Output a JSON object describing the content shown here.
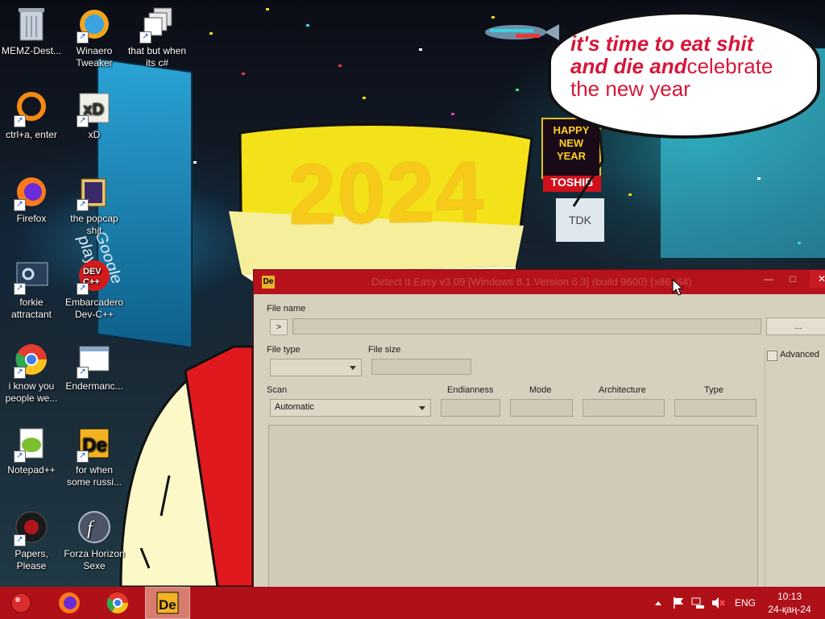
{
  "desktop": {
    "icons": [
      {
        "label": "MEMZ-Dest...",
        "icon": "recycle-bin-icon"
      },
      {
        "label": "Winaero Tweaker",
        "icon": "winaero-icon"
      },
      {
        "label": "that but when its c#",
        "icon": "stacked-windows-icon"
      },
      {
        "label": "ctrl+a, enter",
        "icon": "orange-ring-icon"
      },
      {
        "label": "xD",
        "icon": "hxd-icon"
      },
      {
        "label": "Firefox",
        "icon": "firefox-icon"
      },
      {
        "label": "the popcap shit",
        "icon": "popcap-icon"
      },
      {
        "label": "forkie attractant",
        "icon": "settings-monitor-icon"
      },
      {
        "label": "Embarcadero Dev-C++",
        "icon": "devcpp-icon"
      },
      {
        "label": "i know you people we...",
        "icon": "chrome-icon"
      },
      {
        "label": "Endermanc...",
        "icon": "window-app-icon"
      },
      {
        "label": "Notepad++",
        "icon": "notepadpp-icon"
      },
      {
        "label": "for when some russi...",
        "icon": "detect-it-easy-icon"
      },
      {
        "label": "Papers, Please",
        "icon": "papers-please-icon"
      },
      {
        "label": "Forza Horizon Sexe",
        "icon": "flash-icon"
      }
    ]
  },
  "wallpaper": {
    "bubble_text_1": "it's time to eat shit",
    "bubble_text_2": "and die and",
    "bubble_text_3": "celebrate",
    "bubble_text_4": "the new year",
    "hat_text": "2024",
    "sign_happy": "HAPPY",
    "sign_new": "NEW",
    "sign_year": "YEAR",
    "sign_toshiba": "TOSHIB",
    "sign_tdk": "TDK",
    "sign_google_play": "Google play"
  },
  "window": {
    "icon_text": "De",
    "title": "Detect It Easy v3.09 [Windows 8.1 Version 6.3] (build 9600) (x86_64)",
    "minimize": "—",
    "maximize": "□",
    "close": "✕",
    "file_name_label": "File name",
    "open_button": ">",
    "browse_button": "...",
    "file_type_label": "File type",
    "file_size_label": "File size",
    "advanced_label": "Advanced",
    "scan_label": "Scan",
    "scan_value": "Automatic",
    "endianness_label": "Endianness",
    "mode_label": "Mode",
    "architecture_label": "Architecture",
    "type_label": "Type"
  },
  "taskbar": {
    "language": "ENG",
    "time": "10:13",
    "date": "24-қаң-24"
  },
  "colors": {
    "taskbar": "#b01018",
    "titlebar": "#b5121b",
    "bubble_text": "#d6173a",
    "hat": "#f3e21a"
  }
}
